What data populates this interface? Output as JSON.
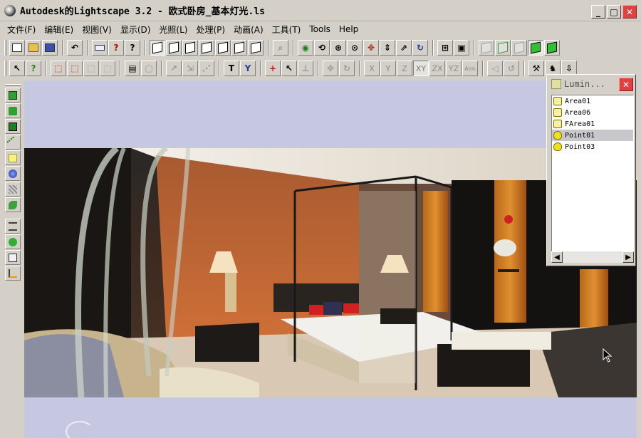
{
  "window": {
    "title": "Autodesk的Lightscape 3.2  - 欧式卧房_基本灯光.ls",
    "minimize": "_",
    "maximize": "□",
    "close": "✕"
  },
  "menu": [
    "文件(F)",
    "编辑(E)",
    "视图(V)",
    "显示(D)",
    "光照(L)",
    "处理(P)",
    "动画(A)",
    "工具(T)",
    "Tools",
    "Help"
  ],
  "toolbar_axes": [
    "X",
    "Y",
    "Z",
    "XY",
    "ZX",
    "YZ",
    "Aim"
  ],
  "luminaire_panel": {
    "title": "Lumin...",
    "items": [
      {
        "label": "Area01",
        "type": "area"
      },
      {
        "label": "Area06",
        "type": "area"
      },
      {
        "label": "FArea01",
        "type": "area"
      },
      {
        "label": "Point01",
        "type": "point",
        "selected": true
      },
      {
        "label": "Point03",
        "type": "point"
      }
    ]
  },
  "colors": {
    "workspace_bg": "#c6c8e2",
    "accent_close": "#e04040",
    "active_cube": "#30c030"
  }
}
